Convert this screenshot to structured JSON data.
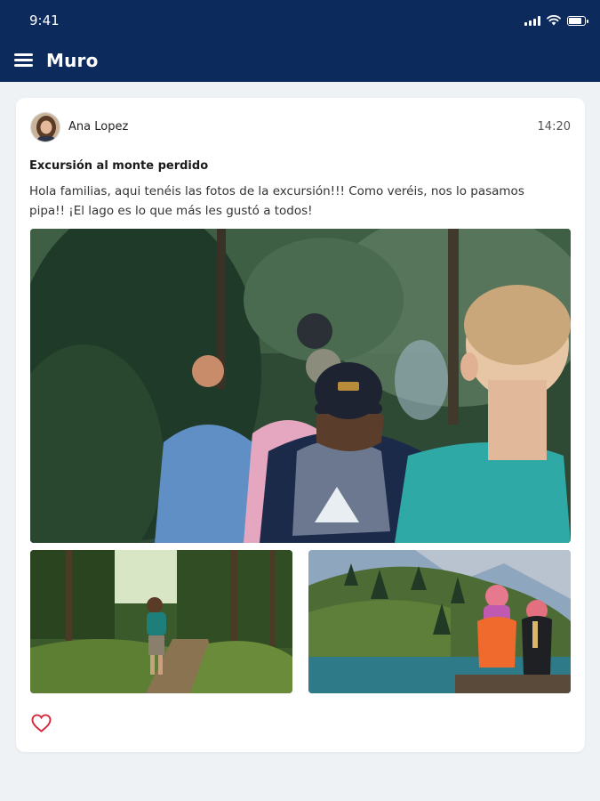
{
  "status_bar": {
    "time": "9:41",
    "icons": [
      "signal-icon",
      "wifi-icon",
      "battery-icon"
    ]
  },
  "header": {
    "menu_icon": "hamburger-menu-icon",
    "title": "Muro"
  },
  "post": {
    "author": "Ana Lopez",
    "time": "14:20",
    "title": "Excursión al monte perdido",
    "body": "Hola familias, aqui tenéis las fotos de la excursión!!! Como veréis, nos lo pasamos pipa!! ¡El lago es lo que más les gustó a todos!",
    "photos": [
      "hikers-forest-photo",
      "child-forest-trail-photo",
      "girls-by-lake-photo"
    ],
    "like_icon": "heart-outline-icon"
  },
  "colors": {
    "header_bg": "#0c2a5b",
    "page_bg": "#eef2f5",
    "card_bg": "#ffffff",
    "like": "#d8283c"
  }
}
